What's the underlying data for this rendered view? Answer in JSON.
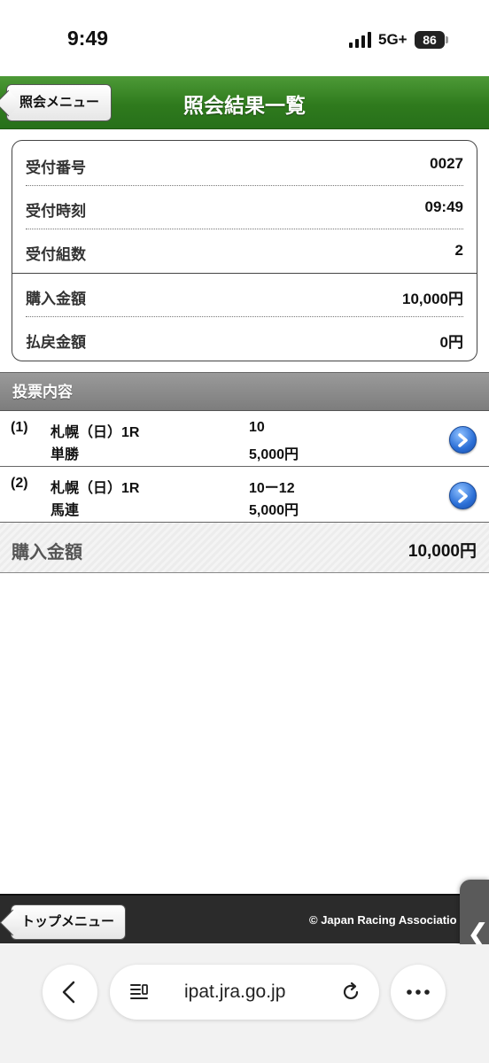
{
  "status_bar": {
    "time": "9:49",
    "network": "5G+",
    "battery": "86"
  },
  "header": {
    "back_label": "照会メニュー",
    "title": "照会結果一覧"
  },
  "receipt": [
    {
      "label": "受付番号",
      "value": "0027"
    },
    {
      "label": "受付時刻",
      "value": "09:49"
    },
    {
      "label": "受付組数",
      "value": "2"
    },
    {
      "label": "購入金額",
      "value": "10,000円"
    },
    {
      "label": "払戻金額",
      "value": "0円"
    }
  ],
  "bets": {
    "heading": "投票内容",
    "items": [
      {
        "num": "(1)",
        "race": "札幌（日）1R",
        "type": "単勝",
        "combo": "10",
        "amount": "5,000円"
      },
      {
        "num": "(2)",
        "race": "札幌（日）1R",
        "type": "馬連",
        "combo": "10ー12",
        "amount": "5,000円"
      }
    ],
    "total_label": "購入金額",
    "total_value": "10,000円"
  },
  "footer": {
    "top_menu_label": "トップメニュー",
    "copyright": "© Japan Racing Associatio"
  },
  "browser": {
    "url": "ipat.jra.go.jp"
  },
  "colors": {
    "header_green": "#2f7a1d",
    "section_gray": "#8a8a8a",
    "arrow_blue": "#2b6fd6"
  },
  "icons": [
    "signal-icon",
    "battery-icon",
    "arrow-right-icon",
    "back-icon",
    "reader-icon",
    "reload-icon",
    "more-icon",
    "chevron-left-icon"
  ]
}
